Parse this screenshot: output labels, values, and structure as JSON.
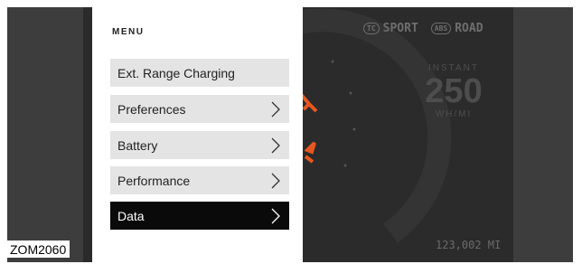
{
  "menu": {
    "title": "MENU",
    "items": [
      {
        "label": "Ext. Range Charging",
        "chevron": false,
        "active": false
      },
      {
        "label": "Preferences",
        "chevron": true,
        "active": false
      },
      {
        "label": "Battery",
        "chevron": true,
        "active": false
      },
      {
        "label": "Performance",
        "chevron": true,
        "active": false
      },
      {
        "label": "Data",
        "chevron": true,
        "active": true
      }
    ]
  },
  "status": {
    "tc_badge": "TC",
    "sport": "SPORT",
    "abs_badge": "ABS",
    "road": "ROAD"
  },
  "instant": {
    "label": "INSTANT",
    "value": "250",
    "unit": "WH/MI"
  },
  "odometer": "123,002 MI",
  "figure_code": "ZOM2060",
  "colors": {
    "accent": "#e8571f",
    "active_item": "#0a0a0a",
    "item_bg": "#e4e4e4"
  }
}
